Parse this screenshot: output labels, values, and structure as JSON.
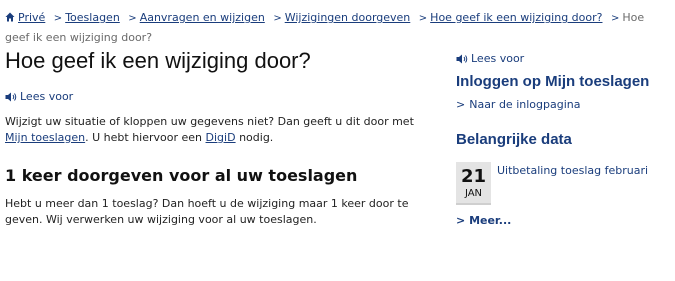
{
  "breadcrumb": {
    "items": [
      "Privé",
      "Toeslagen",
      "Aanvragen en wijzigen",
      "Wijzigingen doorgeven",
      "Hoe geef ik een wijziging door?"
    ],
    "current": "Hoe geef ik een wijziging door?"
  },
  "main": {
    "title": "Hoe geef ik een wijziging door?",
    "read_aloud": "Lees voor",
    "intro": {
      "text1": "Wijzigt uw situatie of kloppen uw gegevens niet? Dan geeft u dit door met ",
      "link1": "Mijn toeslagen",
      "text2": ". U hebt hiervoor een ",
      "link2": "DigiD",
      "text3": " nodig."
    },
    "section_heading": "1 keer doorgeven voor al uw toeslagen",
    "section_text": "Hebt u meer dan 1 toeslag? Dan hoeft u de wijziging maar 1 keer door te geven. Wij verwerken uw wijziging voor al uw toeslagen."
  },
  "sidebar": {
    "read_aloud": "Lees voor",
    "login_heading": "Inloggen op Mijn toeslagen",
    "login_link": "Naar de inlogpagina",
    "dates_heading": "Belangrijke data",
    "event": {
      "day": "21",
      "month": "JAN",
      "label": "Uitbetaling toeslag februari"
    },
    "more": "Meer..."
  },
  "icons": {
    "home": "home-icon",
    "speaker": "speaker-icon",
    "chevron": "chevron-right-icon"
  },
  "colors": {
    "link": "#1a3d7c",
    "date_box": "#e4e4e4"
  }
}
